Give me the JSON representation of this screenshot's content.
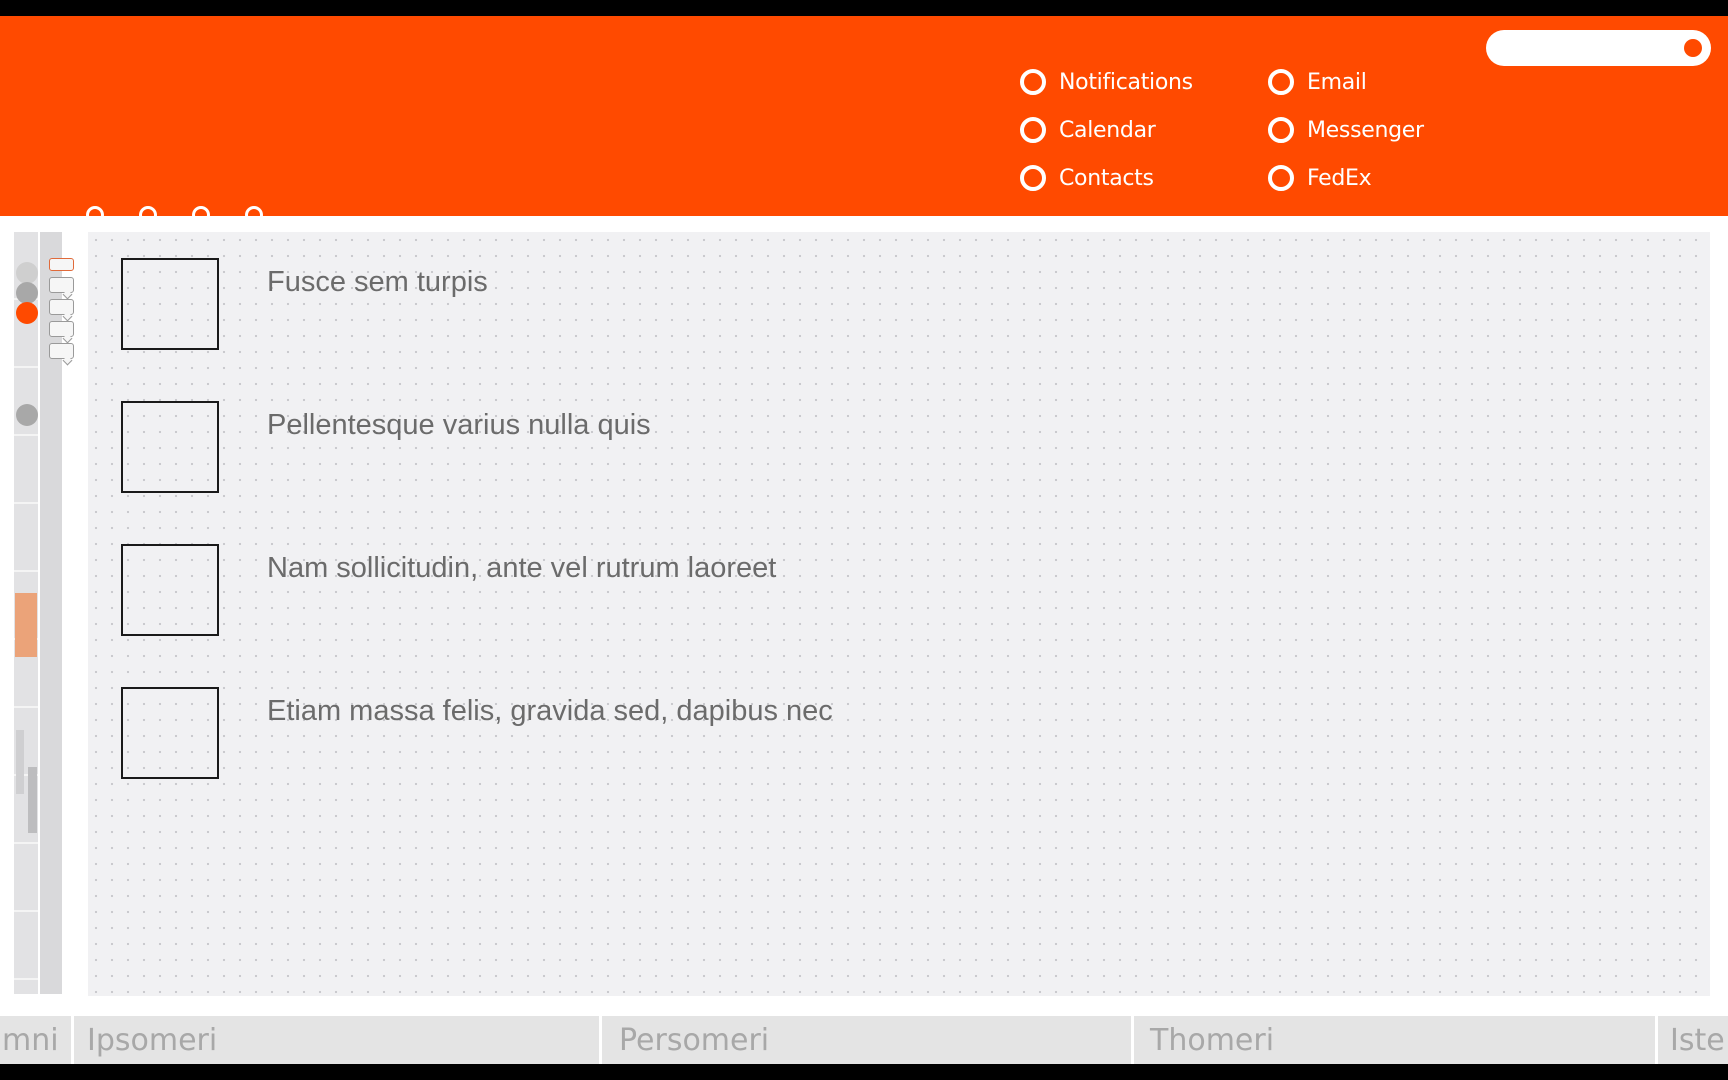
{
  "header": {
    "nav_left": [
      {
        "label": "Notifications",
        "icon": "ring-icon"
      },
      {
        "label": "Calendar",
        "icon": "ring-icon"
      },
      {
        "label": "Contacts",
        "icon": "ring-icon"
      }
    ],
    "nav_right": [
      {
        "label": "Email",
        "icon": "ring-icon"
      },
      {
        "label": "Messenger",
        "icon": "ring-icon"
      },
      {
        "label": "FedEx",
        "icon": "ring-icon"
      }
    ]
  },
  "tasks": [
    {
      "label": "Fusce sem turpis",
      "checked": false
    },
    {
      "label": "Pellentesque varius nulla quis",
      "checked": false
    },
    {
      "label": "Nam sollicitudin, ante vel rutrum laoreet",
      "checked": false
    },
    {
      "label": "Etiam massa felis, gravida sed, dapibus nec",
      "checked": false
    }
  ],
  "bottom_tabs": [
    "mni",
    "Ipsomeri",
    "Persomeri",
    "Thomeri",
    "Iste"
  ],
  "colors": {
    "accent": "#ff4a00",
    "rail_block": "#eba379",
    "content_bg": "#f1f1f3",
    "text_muted": "#6b6b6b"
  }
}
